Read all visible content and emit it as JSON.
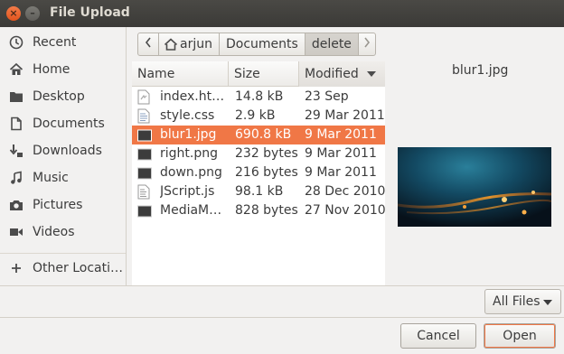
{
  "window": {
    "title": "File Upload"
  },
  "sidebar": {
    "items": [
      {
        "label": "Recent",
        "icon": "clock-icon"
      },
      {
        "label": "Home",
        "icon": "home-icon"
      },
      {
        "label": "Desktop",
        "icon": "folder-icon"
      },
      {
        "label": "Documents",
        "icon": "document-icon"
      },
      {
        "label": "Downloads",
        "icon": "download-icon"
      },
      {
        "label": "Music",
        "icon": "music-icon"
      },
      {
        "label": "Pictures",
        "icon": "camera-icon"
      },
      {
        "label": "Videos",
        "icon": "video-icon"
      }
    ],
    "other": {
      "label": "Other Locati…",
      "icon": "plus-icon"
    }
  },
  "pathbar": {
    "segments": [
      "arjun",
      "Documents",
      "delete"
    ],
    "active": "delete"
  },
  "filelist": {
    "headers": {
      "name": "Name",
      "size": "Size",
      "modified": "Modified"
    },
    "sort": "modified-descending",
    "rows": [
      {
        "name": "index.ht…",
        "size": "14.8 kB",
        "modified": "23 Sep",
        "icon": "html-file-icon",
        "selected": false
      },
      {
        "name": "style.css",
        "size": "2.9 kB",
        "modified": "29 Mar 2011",
        "icon": "text-file-icon",
        "selected": false
      },
      {
        "name": "blur1.jpg",
        "size": "690.8 kB",
        "modified": "9 Mar 2011",
        "icon": "image-file-icon",
        "selected": true
      },
      {
        "name": "right.png",
        "size": "232 bytes",
        "modified": "9 Mar 2011",
        "icon": "image-file-icon",
        "selected": false
      },
      {
        "name": "down.png",
        "size": "216 bytes",
        "modified": "9 Mar 2011",
        "icon": "image-file-icon",
        "selected": false
      },
      {
        "name": "JScript.js",
        "size": "98.1 kB",
        "modified": "28 Dec 2010",
        "icon": "script-file-icon",
        "selected": false
      },
      {
        "name": "MediaM…",
        "size": "828 bytes",
        "modified": "27 Nov 2010",
        "icon": "image-file-icon",
        "selected": false
      }
    ]
  },
  "preview": {
    "filename": "blur1.jpg"
  },
  "filter": {
    "selected": "All Files"
  },
  "buttons": {
    "cancel": "Cancel",
    "open": "Open"
  },
  "colors": {
    "accent": "#f07746",
    "titlebar": "#3f3e3b",
    "close": "#e9612c"
  }
}
